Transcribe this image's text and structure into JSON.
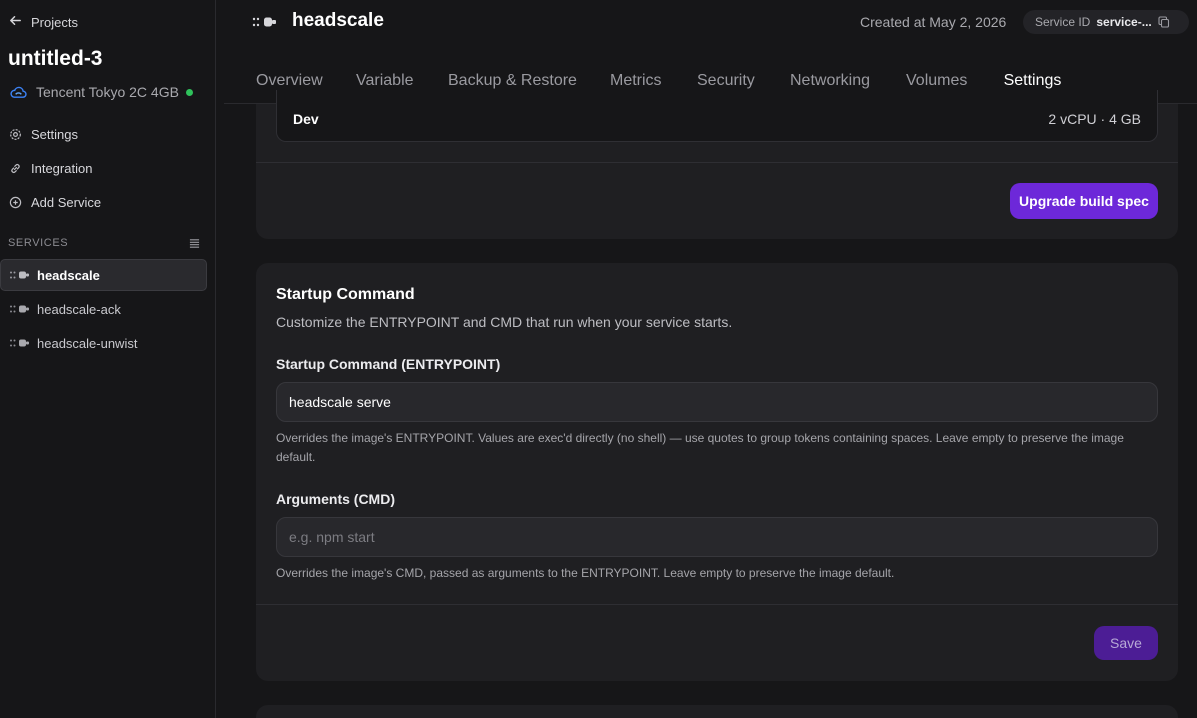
{
  "sidebar": {
    "back_label": "Projects",
    "project_name": "untitled-3",
    "region": "Tencent Tokyo 2C 4GB",
    "nav": [
      {
        "label": "Settings",
        "icon": "gear-icon"
      },
      {
        "label": "Integration",
        "icon": "link-icon"
      },
      {
        "label": "Add Service",
        "icon": "plus-circle-icon"
      }
    ],
    "services_label": "SERVICES",
    "services": [
      {
        "label": "headscale",
        "active": true
      },
      {
        "label": "headscale-ack",
        "active": false
      },
      {
        "label": "headscale-unwist",
        "active": false
      }
    ]
  },
  "header": {
    "title": "headscale",
    "created_at": "Created at May 2, 2026",
    "service_id_label": "Service ID",
    "service_id_value": "service-..."
  },
  "tabs": [
    {
      "label": "Overview",
      "active": false
    },
    {
      "label": "Variable",
      "active": false
    },
    {
      "label": "Backup & Restore",
      "active": false
    },
    {
      "label": "Metrics",
      "active": false
    },
    {
      "label": "Security",
      "active": false
    },
    {
      "label": "Networking",
      "active": false
    },
    {
      "label": "Volumes",
      "active": false
    },
    {
      "label": "Settings",
      "active": true
    }
  ],
  "build_spec": {
    "name": "Dev",
    "value": "2 vCPU · 4 GB",
    "upgrade_label": "Upgrade build spec"
  },
  "startup": {
    "title": "Startup Command",
    "description": "Customize the ENTRYPOINT and CMD that run when your service starts.",
    "entrypoint_label": "Startup Command (ENTRYPOINT)",
    "entrypoint_value": "headscale serve",
    "entrypoint_help": "Overrides the image's ENTRYPOINT. Values are exec'd directly (no shell) — use quotes to group tokens containing spaces. Leave empty to preserve the image default.",
    "cmd_label": "Arguments (CMD)",
    "cmd_value": "",
    "cmd_placeholder": "e.g. npm start",
    "cmd_help": "Overrides the image's CMD, passed as arguments to the ENTRYPOINT. Leave empty to preserve the image default.",
    "save_label": "Save"
  },
  "colors": {
    "accent": "#6d28d9",
    "status_online": "#2fc25b",
    "region_cloud": "#3b82f6"
  }
}
